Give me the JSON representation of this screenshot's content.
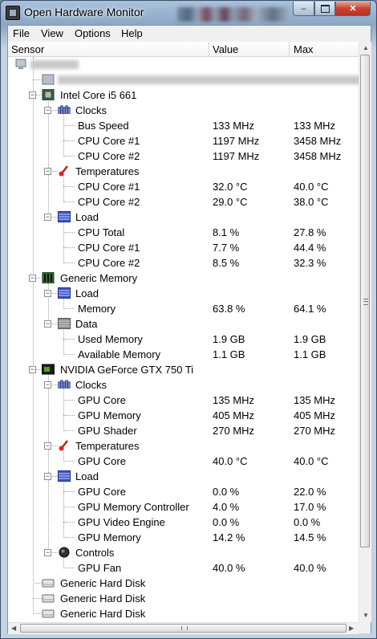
{
  "window": {
    "title": "Open Hardware Monitor",
    "controls": {
      "minimize": "–",
      "close": "✕"
    }
  },
  "menu": [
    "File",
    "View",
    "Options",
    "Help"
  ],
  "columns": {
    "sensor": "Sensor",
    "value": "Value",
    "max": "Max"
  },
  "tree": [
    {
      "label": "",
      "value": "",
      "max": "",
      "icon": "computer-icon",
      "level": 0,
      "blurred": true
    },
    {
      "label": "",
      "value": "",
      "max": "",
      "icon": "mainboard-icon",
      "level": 1,
      "blurred": true
    },
    {
      "label": "Intel Core i5 661",
      "value": "",
      "max": "",
      "icon": "cpu-icon",
      "level": 1,
      "expander": "−"
    },
    {
      "label": "Clocks",
      "value": "",
      "max": "",
      "icon": "clock-icon",
      "level": 2,
      "expander": "−"
    },
    {
      "label": "Bus Speed",
      "value": "133 MHz",
      "max": "133 MHz",
      "level": 3
    },
    {
      "label": "CPU Core #1",
      "value": "1197 MHz",
      "max": "3458 MHz",
      "level": 3
    },
    {
      "label": "CPU Core #2",
      "value": "1197 MHz",
      "max": "3458 MHz",
      "level": 3
    },
    {
      "label": "Temperatures",
      "value": "",
      "max": "",
      "icon": "thermometer-icon",
      "level": 2,
      "expander": "−"
    },
    {
      "label": "CPU Core #1",
      "value": "32.0 °C",
      "max": "40.0 °C",
      "level": 3
    },
    {
      "label": "CPU Core #2",
      "value": "29.0 °C",
      "max": "38.0 °C",
      "level": 3
    },
    {
      "label": "Load",
      "value": "",
      "max": "",
      "icon": "load-icon",
      "level": 2,
      "expander": "−"
    },
    {
      "label": "CPU Total",
      "value": "8.1 %",
      "max": "27.8 %",
      "level": 3
    },
    {
      "label": "CPU Core #1",
      "value": "7.7 %",
      "max": "44.4 %",
      "level": 3
    },
    {
      "label": "CPU Core #2",
      "value": "8.5 %",
      "max": "32.3 %",
      "level": 3
    },
    {
      "label": "Generic Memory",
      "value": "",
      "max": "",
      "icon": "ram-icon",
      "level": 1,
      "expander": "−"
    },
    {
      "label": "Load",
      "value": "",
      "max": "",
      "icon": "load-icon",
      "level": 2,
      "expander": "−"
    },
    {
      "label": "Memory",
      "value": "63.8 %",
      "max": "64.1 %",
      "level": 3
    },
    {
      "label": "Data",
      "value": "",
      "max": "",
      "icon": "data-icon",
      "level": 2,
      "expander": "−"
    },
    {
      "label": "Used Memory",
      "value": "1.9 GB",
      "max": "1.9 GB",
      "level": 3
    },
    {
      "label": "Available Memory",
      "value": "1.1 GB",
      "max": "1.1 GB",
      "level": 3
    },
    {
      "label": "NVIDIA GeForce GTX 750 Ti",
      "value": "",
      "max": "",
      "icon": "gpu-icon",
      "level": 1,
      "expander": "−"
    },
    {
      "label": "Clocks",
      "value": "",
      "max": "",
      "icon": "clock-icon",
      "level": 2,
      "expander": "−"
    },
    {
      "label": "GPU Core",
      "value": "135 MHz",
      "max": "135 MHz",
      "level": 3
    },
    {
      "label": "GPU Memory",
      "value": "405 MHz",
      "max": "405 MHz",
      "level": 3
    },
    {
      "label": "GPU Shader",
      "value": "270 MHz",
      "max": "270 MHz",
      "level": 3
    },
    {
      "label": "Temperatures",
      "value": "",
      "max": "",
      "icon": "thermometer-icon",
      "level": 2,
      "expander": "−"
    },
    {
      "label": "GPU Core",
      "value": "40.0 °C",
      "max": "40.0 °C",
      "level": 3
    },
    {
      "label": "Load",
      "value": "",
      "max": "",
      "icon": "load-icon",
      "level": 2,
      "expander": "−"
    },
    {
      "label": "GPU Core",
      "value": "0.0 %",
      "max": "22.0 %",
      "level": 3
    },
    {
      "label": "GPU Memory Controller",
      "value": "4.0 %",
      "max": "17.0 %",
      "level": 3
    },
    {
      "label": "GPU Video Engine",
      "value": "0.0 %",
      "max": "0.0 %",
      "level": 3
    },
    {
      "label": "GPU Memory",
      "value": "14.2 %",
      "max": "14.5 %",
      "level": 3
    },
    {
      "label": "Controls",
      "value": "",
      "max": "",
      "icon": "fan-icon",
      "level": 2,
      "expander": "−"
    },
    {
      "label": "GPU Fan",
      "value": "40.0 %",
      "max": "40.0 %",
      "level": 3
    },
    {
      "label": "Generic Hard Disk",
      "value": "",
      "max": "",
      "icon": "hdd-icon",
      "level": 1
    },
    {
      "label": "Generic Hard Disk",
      "value": "",
      "max": "",
      "icon": "hdd-icon",
      "level": 1
    },
    {
      "label": "Generic Hard Disk",
      "value": "",
      "max": "",
      "icon": "hdd-icon",
      "level": 1
    }
  ]
}
